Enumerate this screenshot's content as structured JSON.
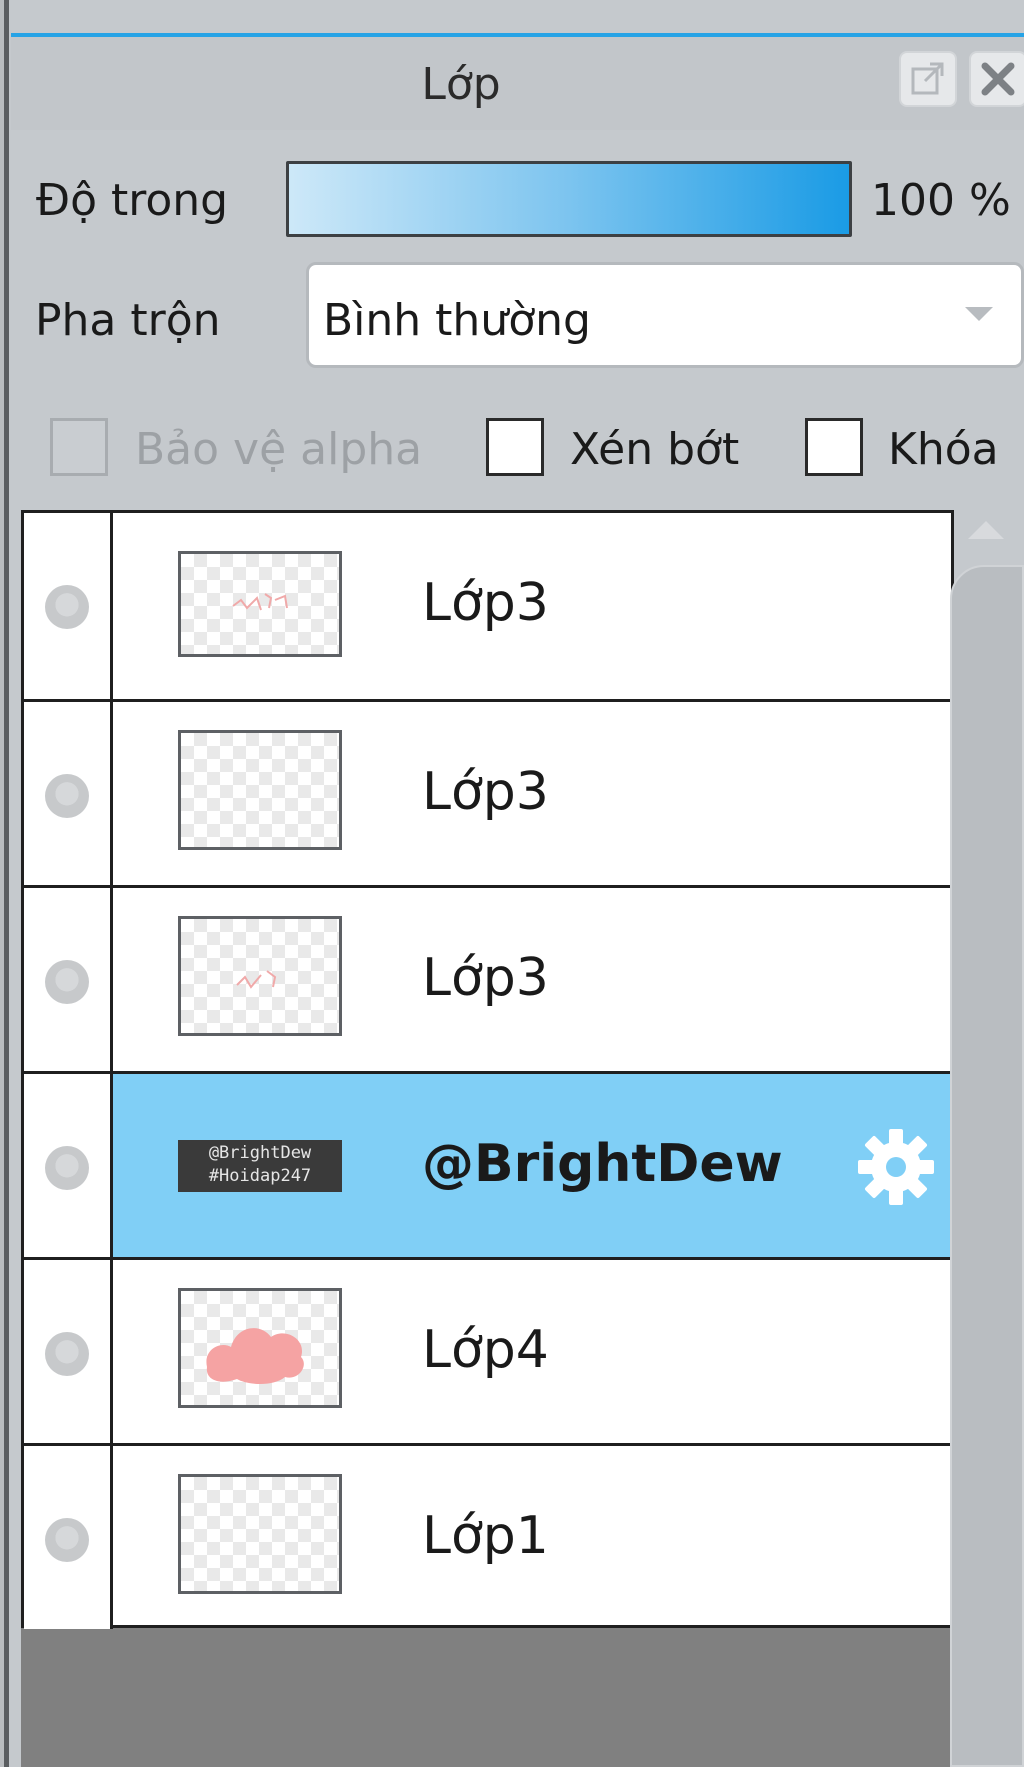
{
  "panel": {
    "title": "Lớp",
    "float_icon": "float-window-icon",
    "close_icon": "close-icon"
  },
  "opacity": {
    "label": "Độ trong",
    "value_text": "100 %",
    "value": 100
  },
  "blending": {
    "label": "Pha trộn",
    "selected": "Bình thường"
  },
  "options": [
    {
      "label": "Bảo vệ alpha",
      "checked": false,
      "enabled": false
    },
    {
      "label": "Xén bớt",
      "checked": false,
      "enabled": true
    },
    {
      "label": "Khóa",
      "checked": false,
      "enabled": true
    }
  ],
  "layers": [
    {
      "name": "Lớp3",
      "selected": false
    },
    {
      "name": "Lớp3",
      "selected": false
    },
    {
      "name": "Lớp3",
      "selected": false
    },
    {
      "name": "@BrightDew",
      "selected": true,
      "thumb_lines": [
        "@BrightDew",
        "#Hoidap247"
      ],
      "settings_icon": "gear-icon"
    },
    {
      "name": "Lớp4",
      "selected": false
    },
    {
      "name": "Lớp1",
      "selected": false
    }
  ],
  "colors": {
    "accent": "#26a3e6",
    "selected_row": "#80cff6",
    "panel_bg": "#c5c9cd"
  }
}
